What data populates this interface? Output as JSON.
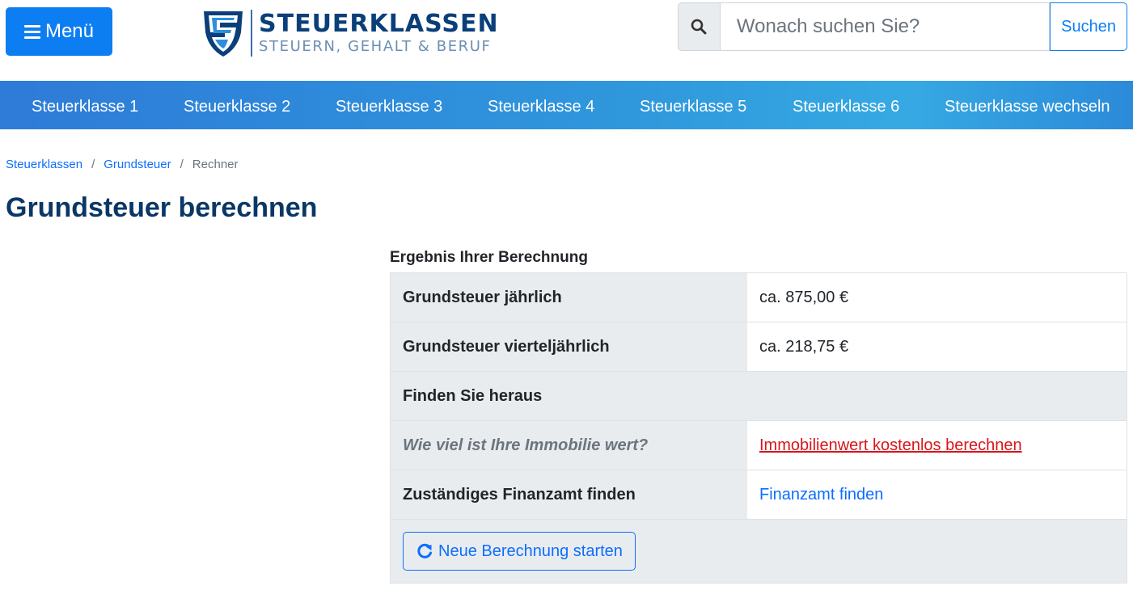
{
  "header": {
    "menu_label": "Menü",
    "logo_title": "STEUERKLASSEN",
    "logo_subtitle": "STEUERN, GEHALT & BERUF",
    "search_placeholder": "Wonach suchen Sie?",
    "search_button": "Suchen"
  },
  "nav": {
    "items": [
      {
        "label": "Steuerklasse 1"
      },
      {
        "label": "Steuerklasse 2"
      },
      {
        "label": "Steuerklasse 3"
      },
      {
        "label": "Steuerklasse 4"
      },
      {
        "label": "Steuerklasse 5"
      },
      {
        "label": "Steuerklasse 6"
      },
      {
        "label": "Steuerklasse wechseln"
      }
    ]
  },
  "breadcrumb": {
    "items": [
      "Steuerklassen",
      "Grundsteuer"
    ],
    "current": "Rechner",
    "separator": "/"
  },
  "page": {
    "title": "Grundsteuer berechnen"
  },
  "result": {
    "caption": "Ergebnis Ihrer Berechnung",
    "rows": [
      {
        "label": "Grundsteuer jährlich",
        "value": "ca. 875,00 €"
      },
      {
        "label": "Grundsteuer vierteljährlich",
        "value": "ca. 218,75 €"
      }
    ],
    "section_heading": "Finden Sie heraus",
    "property_question": "Wie viel ist Ihre Immobilie wert?",
    "property_link": "Immobilienwert kostenlos berechnen",
    "finanzamt_label": "Zuständiges Finanzamt finden",
    "finanzamt_link": "Finanzamt finden",
    "restart_button": "Neue Berechnung starten"
  },
  "colors": {
    "primary": "#0d7ef2",
    "title": "#0a3766",
    "nav_gradient_start": "#2e7bd8",
    "nav_gradient_end": "#36a9e3",
    "link_red": "#d9141b"
  }
}
